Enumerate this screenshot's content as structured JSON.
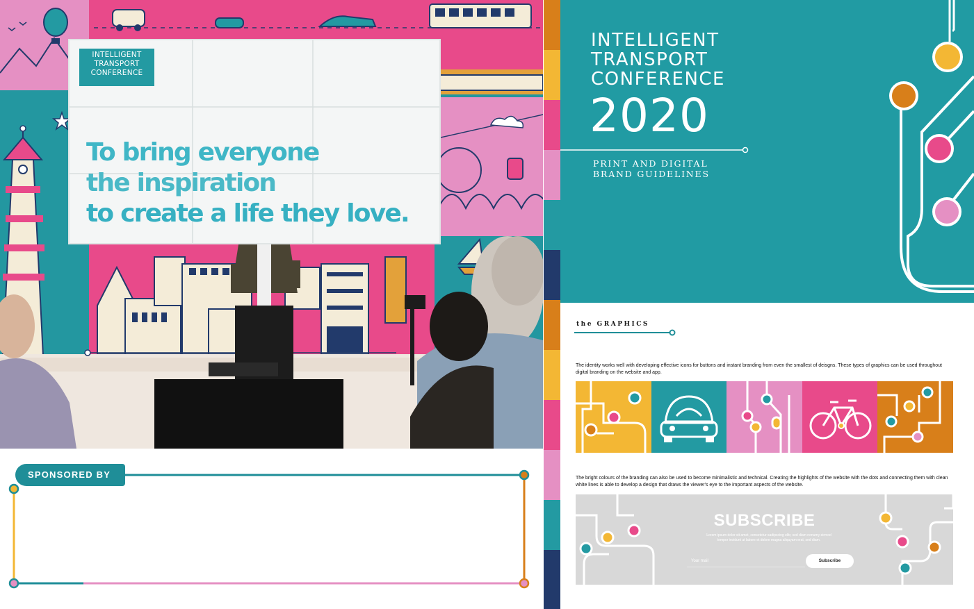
{
  "stage": {
    "logo_lines": [
      "INTELLIGENT",
      "TRANSPORT",
      "CONFERENCE"
    ],
    "slogan_lines": [
      "To bring everyone",
      "the inspiration",
      "to create a life they love."
    ]
  },
  "sponsor": {
    "label": "SPONSORED BY"
  },
  "cover": {
    "title_lines": [
      "INTELLIGENT",
      "TRANSPORT",
      "CONFERENCE"
    ],
    "year": "2020",
    "subtitle_lines": [
      "PRINT AND DIGITAL",
      "BRAND GUIDELINES"
    ]
  },
  "graphics": {
    "section_title": "the GRAPHICS",
    "paragraph_1": "The identity works well with developing effective icons for buttons and instant branding from even the smallest of deisgns. These types of graphics can be used throughout digital branding on the website and app.",
    "paragraph_2": "The bright colours of the branding can also be used to become minimalistic and technical. Creating the highlights of the website with the dots and connecting them with clean white lines is able to develop a design that draws the viewer's eye to the important aspects of the website.",
    "tiles": [
      {
        "name": "circuit-yellow",
        "color": "#f3b734"
      },
      {
        "name": "car-teal",
        "color": "#239aa2"
      },
      {
        "name": "circuit-lightpink",
        "color": "#e590c3"
      },
      {
        "name": "bicycle-pink",
        "color": "#e84a8a"
      },
      {
        "name": "circuit-orange",
        "color": "#d87f1a"
      }
    ]
  },
  "subscribe": {
    "title": "SUBSCRIBE",
    "body": "Lorem ipsum dolor sit amet, consetetur sadipscing elitr, sed diam nonumy eirmod tempor invidunt ut labore et dolore magna aliquyam erat, sed diam.",
    "email_placeholder": "Your mail",
    "button_label": "Subscribe"
  },
  "palette": {
    "teal": "#219ba3",
    "pink": "#e84a8a",
    "light_pink": "#e590c3",
    "yellow": "#f3b734",
    "orange": "#d87f1a",
    "navy": "#223a6b"
  }
}
